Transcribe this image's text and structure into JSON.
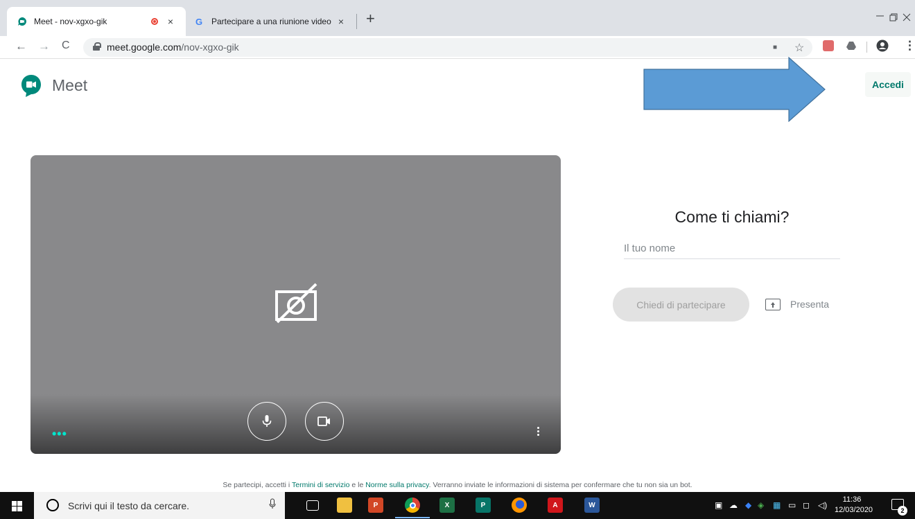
{
  "browser": {
    "tabs": [
      {
        "title": "Meet - nov-xgxo-gik",
        "favicon": "meet-icon",
        "recording": true
      },
      {
        "title": "Partecipare a una riunione video",
        "favicon": "google-icon"
      }
    ],
    "close_glyph": "×",
    "new_tab_glyph": "+",
    "window_controls": {
      "minimize": "—",
      "restore": "❐",
      "close": "✕"
    },
    "nav": {
      "back": "←",
      "forward": "→",
      "reload": "C"
    },
    "url": {
      "domain": "meet.google.com",
      "path": "/nov-xgxo-gik"
    },
    "omnibox_icons": {
      "camera": "■",
      "star": "☆"
    },
    "menu_glyph": "⋮"
  },
  "meet": {
    "brand": "Meet",
    "sign_in": "Accedi",
    "join": {
      "title": "Come ti chiami?",
      "name_placeholder": "Il tuo nome",
      "ask_to_join": "Chiedi di partecipare",
      "present": "Presenta"
    },
    "preview": {
      "camera_state": "off",
      "dots": "•••"
    },
    "footer": {
      "prefix": "Se partecipi, accetti i ",
      "terms": "Termini di servizio",
      "and": " e le ",
      "privacy": "Norme sulla privacy",
      "suffix": ". Verranno inviate le informazioni di sistema per confermare che tu non sia un bot."
    }
  },
  "annotation": {
    "arrow_color": "#5b9bd5"
  },
  "taskbar": {
    "search_placeholder": "Scrivi qui il testo da cercare.",
    "apps": [
      "task-view",
      "file-explorer",
      "powerpoint",
      "chrome",
      "excel",
      "publisher",
      "firefox",
      "acrobat",
      "word"
    ],
    "clock": {
      "time": "11:36",
      "date": "12/03/2020"
    },
    "notifications": "2"
  },
  "colors": {
    "meet_green": "#00796b",
    "preview_bg": "#89898b",
    "taskbar_bg": "#101010",
    "tab_strip": "#dee1e6"
  }
}
